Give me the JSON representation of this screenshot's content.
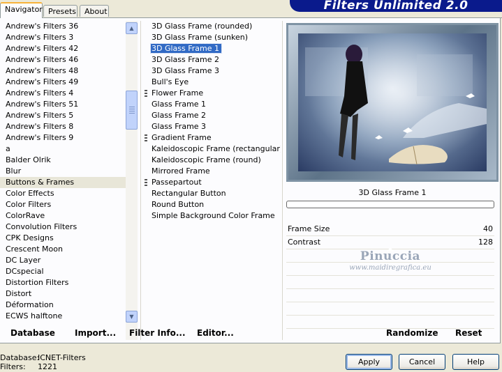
{
  "tabs": [
    {
      "label": "Navigator",
      "active": true
    },
    {
      "label": "Presets",
      "active": false
    },
    {
      "label": "About",
      "active": false
    }
  ],
  "banner": {
    "title": "Filters Unlimited 2.0"
  },
  "categories": [
    "Andrew's Filters 36",
    "Andrew's Filters 3",
    "Andrew's Filters 42",
    "Andrew's Filters 46",
    "Andrew's Filters 48",
    "Andrew's Filters 49",
    "Andrew's Filters 4",
    "Andrew's Filters 51",
    "Andrew's Filters 5",
    "Andrew's Filters 8",
    "Andrew's Filters 9",
    "a",
    "Balder Olrik",
    "Blur",
    "Buttons & Frames",
    "Color Effects",
    "Color Filters",
    "ColorRave",
    "Convolution Filters",
    "CPK Designs",
    "Crescent Moon",
    "DC Layer",
    "DCspecial",
    "Distortion Filters",
    "Distort",
    "Déformation",
    "ECWS halftone"
  ],
  "selected_category": "Buttons & Frames",
  "filters": [
    {
      "label": "3D Glass Frame (rounded)",
      "marked": false
    },
    {
      "label": "3D Glass Frame (sunken)",
      "marked": false
    },
    {
      "label": "3D Glass Frame 1",
      "marked": false,
      "selected": true
    },
    {
      "label": "3D Glass Frame 2",
      "marked": false
    },
    {
      "label": "3D Glass Frame 3",
      "marked": false
    },
    {
      "label": "Bull's Eye",
      "marked": false
    },
    {
      "label": "Flower Frame",
      "marked": true
    },
    {
      "label": "Glass Frame 1",
      "marked": false
    },
    {
      "label": "Glass Frame 2",
      "marked": false
    },
    {
      "label": "Glass Frame 3",
      "marked": false
    },
    {
      "label": "Gradient Frame",
      "marked": true
    },
    {
      "label": "Kaleidoscopic Frame (rectangular)",
      "marked": false
    },
    {
      "label": "Kaleidoscopic Frame (round)",
      "marked": false
    },
    {
      "label": "Mirrored Frame",
      "marked": false
    },
    {
      "label": "Passepartout",
      "marked": true
    },
    {
      "label": "Rectangular Button",
      "marked": false
    },
    {
      "label": "Round Button",
      "marked": false
    },
    {
      "label": "Simple Background Color Frame",
      "marked": false
    }
  ],
  "preview": {
    "caption": "3D Glass Frame 1",
    "progress": 0
  },
  "params": [
    {
      "name": "Frame Size",
      "value": "40",
      "level": 40
    },
    {
      "name": "Contrast",
      "value": "128",
      "level": 128
    }
  ],
  "watermark": {
    "line1": "Pinuccia",
    "line2": "www.maidiregrafica.eu"
  },
  "toolbar": {
    "database": "Database",
    "import": "Import...",
    "filter_info": "Filter Info...",
    "editor": "Editor...",
    "randomize": "Randomize",
    "reset": "Reset"
  },
  "status": {
    "database_label": "Database:",
    "database_value": "ICNET-Filters",
    "filters_label": "Filters:",
    "filters_value": "1221"
  },
  "buttons": {
    "apply": "Apply",
    "cancel": "Cancel",
    "help": "Help"
  },
  "colors": {
    "banner": "#0a1a8c",
    "selection": "#316ac5"
  }
}
